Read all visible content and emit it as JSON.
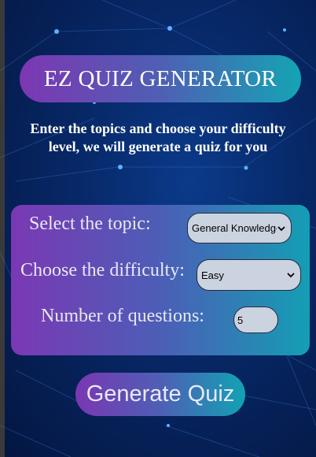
{
  "header": {
    "title": "EZ QUIZ GENERATOR",
    "subtitle": "Enter the topics and choose your difficulty level, we will generate a quiz for you"
  },
  "form": {
    "topic": {
      "label": "Select the topic:",
      "selected": "General Knowledge"
    },
    "difficulty": {
      "label": "Choose the difficulty:",
      "selected": "Easy"
    },
    "questions": {
      "label": "Number of questions:",
      "value": "5"
    }
  },
  "actions": {
    "generate_label": "Generate Quiz"
  },
  "colors": {
    "background": "#072765",
    "gradient_start": "#7d37b3",
    "gradient_end": "#14a4b4",
    "field_bg": "#ccd3e0"
  },
  "icons": {
    "select_arrow": "chevron-down-icon"
  }
}
